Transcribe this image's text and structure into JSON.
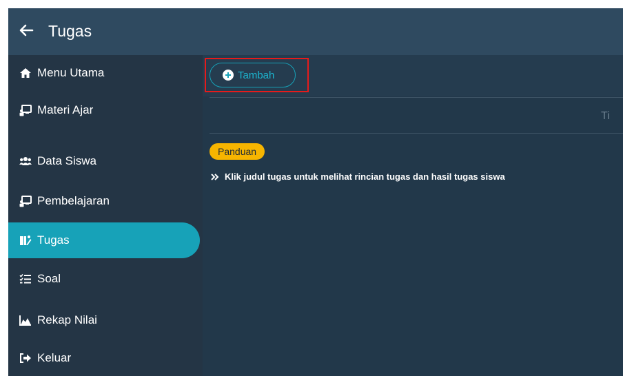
{
  "app": {
    "title": "Tugas",
    "back_icon": "arrow-left-icon"
  },
  "sidebar": {
    "items": [
      {
        "label": "Menu Utama",
        "icon": "home-icon",
        "active": false
      },
      {
        "label": "Materi Ajar",
        "icon": "chalkboard-icon",
        "active": false
      },
      {
        "label": "Data Siswa",
        "icon": "users-icon",
        "active": false
      },
      {
        "label": "Pembelajaran",
        "icon": "chalkboard-icon",
        "active": false
      },
      {
        "label": "Tugas",
        "icon": "tasks-icon",
        "active": true
      },
      {
        "label": "Soal",
        "icon": "list-icon",
        "active": false
      },
      {
        "label": "Rekap Nilai",
        "icon": "chart-area-icon",
        "active": false
      },
      {
        "label": "Keluar",
        "icon": "sign-out-icon",
        "active": false
      }
    ]
  },
  "main": {
    "add_button": {
      "label": "Tambah",
      "icon": "plus-circle-icon"
    },
    "table_header_partial": "Ti",
    "guide": {
      "badge": "Panduan",
      "items": [
        "Klik judul tugas untuk melihat rincian tugas dan hasil tugas siswa"
      ]
    }
  },
  "colors": {
    "topbar": "#2f4a60",
    "sidebar": "#243545",
    "active_item": "#17a2b8",
    "badge": "#f7b500",
    "highlight": "#e61b1b"
  }
}
